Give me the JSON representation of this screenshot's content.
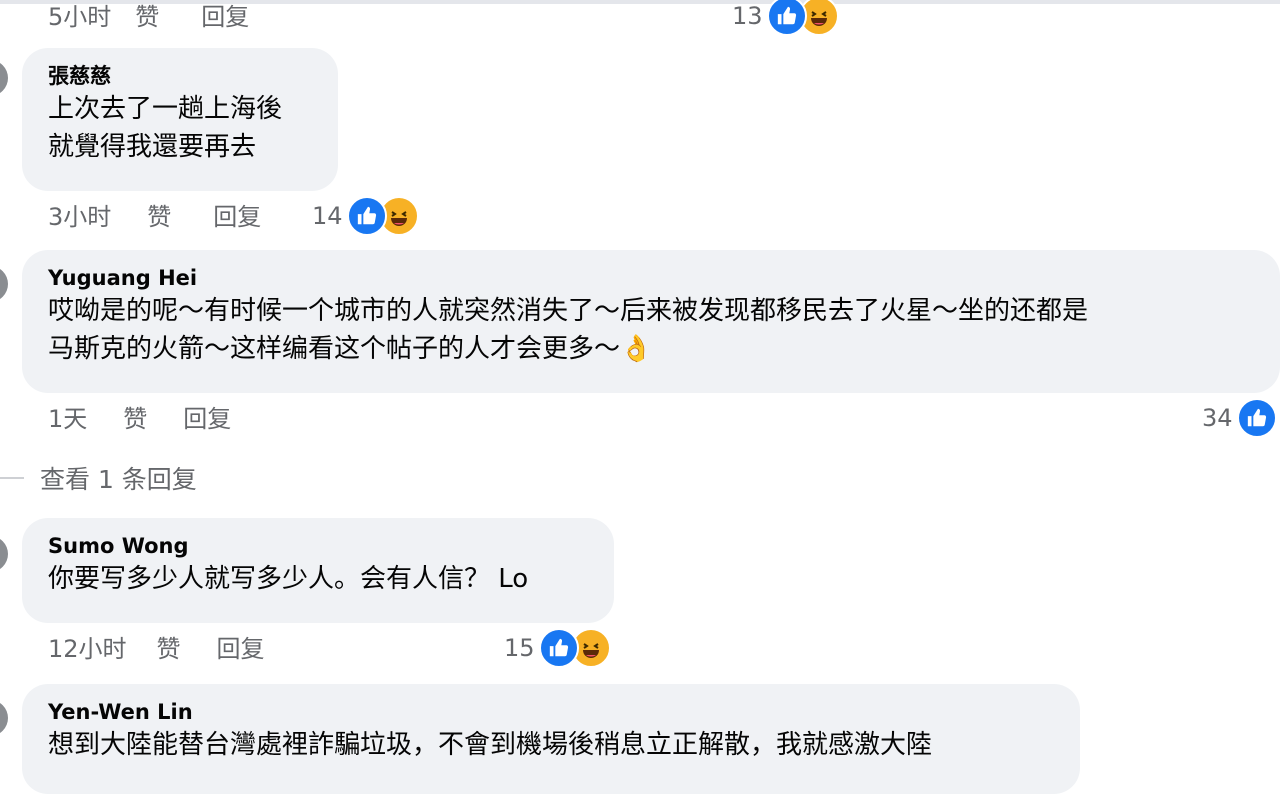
{
  "comments": [
    {
      "time": "5小时",
      "like": "赞",
      "reply": "回复",
      "reaction_count": "13",
      "reactions": [
        "like-icon",
        "haha-icon"
      ]
    },
    {
      "author": "張慈慈",
      "text": "上次去了一趟上海後\n就覺得我還要再去",
      "time": "3小时",
      "like": "赞",
      "reply": "回复",
      "reaction_count": "14",
      "reactions": [
        "like-icon",
        "haha-icon"
      ]
    },
    {
      "author": "Yuguang Hei",
      "text": "哎呦是的呢～有时候一个城市的人就突然消失了～后来被发现都移民去了火星～坐的还都是\n马斯克的火箭～这样编看这个帖子的人才会更多～👌",
      "time": "1天",
      "like": "赞",
      "reply": "回复",
      "reaction_count": "34",
      "reactions": [
        "like-icon"
      ],
      "view_replies": "查看 1 条回复"
    },
    {
      "author": "Sumo Wong",
      "text": "你要写多少人就写多少人。会有人信？ Lo",
      "time": "12小时",
      "like": "赞",
      "reply": "回复",
      "reaction_count": "15",
      "reactions": [
        "like-icon",
        "haha-icon"
      ]
    },
    {
      "author": "Yen-Wen Lin",
      "text": "想到大陸能替台灣處裡詐騙垃圾，不會到機場後稍息立正解散，我就感激大陸"
    }
  ],
  "colors": {
    "bubble": "#f0f2f5",
    "like": "#1877f2",
    "haha": "#f7b125",
    "meta": "#65676b"
  }
}
